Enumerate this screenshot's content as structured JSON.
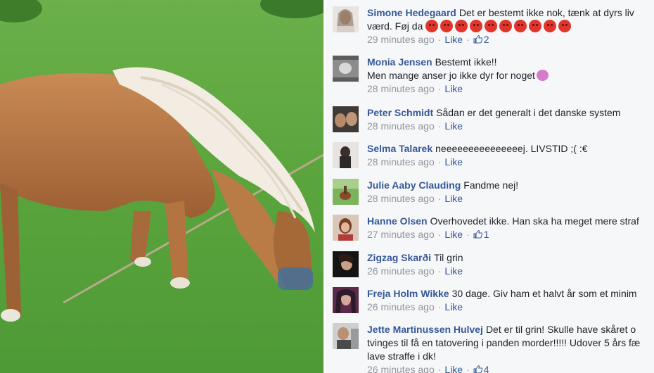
{
  "photo": {
    "subject": "pony grazing on grass"
  },
  "comments": [
    {
      "author": "Simone Hedegaard",
      "text_lines": [
        "Det er bestemt ikke nok, tænk at dyrs liv",
        "værd. Føj da"
      ],
      "emoji_count": 10,
      "time": "29 minutes ago",
      "like_label": "Like",
      "likes": "2"
    },
    {
      "author": "Monia Jensen",
      "text_lines": [
        "Bestemt ikke!!",
        "Men mange anser jo ikke dyr for noget"
      ],
      "time": "28 minutes ago",
      "like_label": "Like"
    },
    {
      "author": "Peter Schmidt",
      "text_lines": [
        "Sådan er det generalt i det danske system"
      ],
      "time": "28 minutes ago",
      "like_label": "Like"
    },
    {
      "author": "Selma Talarek",
      "text_lines": [
        "neeeeeeeeeeeeeeej. LIVSTID ;( :€"
      ],
      "time": "28 minutes ago",
      "like_label": "Like"
    },
    {
      "author": "Julie Aaby Clauding",
      "text_lines": [
        "Fandme nej!"
      ],
      "time": "28 minutes ago",
      "like_label": "Like"
    },
    {
      "author": "Hanne Olsen",
      "text_lines": [
        "Overhovedet ikke. Han ska ha meget mere straf"
      ],
      "time": "27 minutes ago",
      "like_label": "Like",
      "likes": "1"
    },
    {
      "author": "Zigzag Skarði",
      "text_lines": [
        "Til grin"
      ],
      "time": "26 minutes ago",
      "like_label": "Like"
    },
    {
      "author": "Freja Holm Wikke",
      "text_lines": [
        "30 dage. Giv ham et halvt år som et minim"
      ],
      "time": "26 minutes ago",
      "like_label": "Like"
    },
    {
      "author": "Jette Martinussen Hulvej",
      "text_lines": [
        "Det er til grin! Skulle have skåret o",
        "tvinges til få en tatovering i panden morder!!!!! Udover 5 års fæ",
        "lave straffe i dk!"
      ],
      "time": "26 minutes ago",
      "like_label": "Like",
      "likes": "4"
    }
  ],
  "colors": {
    "author": "#365899",
    "meta": "#90949c",
    "text": "#1d2129",
    "feed_bg": "#f6f7f9"
  }
}
